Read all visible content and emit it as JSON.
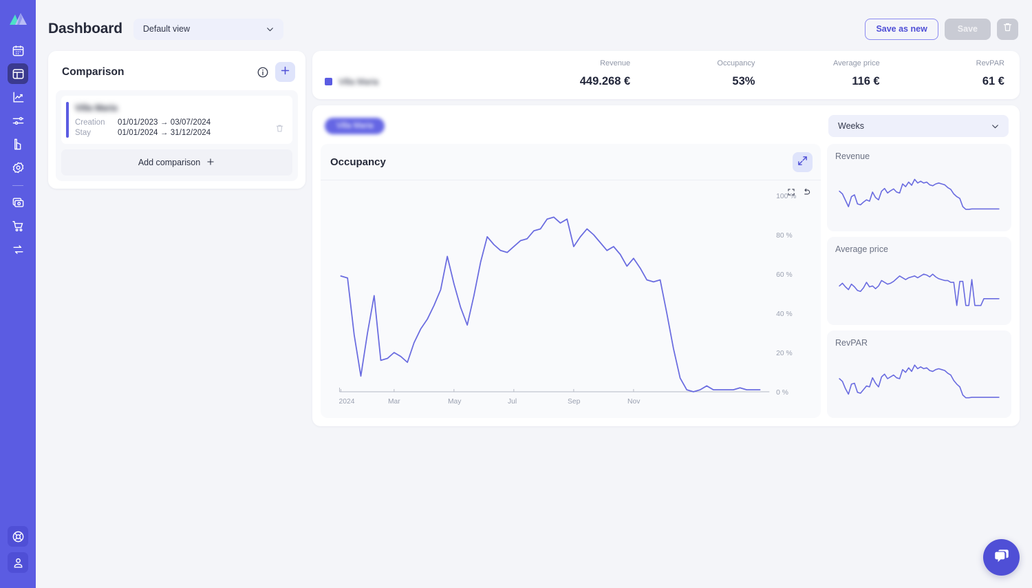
{
  "sidebar": {
    "logo_icon": "mountain-logo",
    "items": [
      {
        "icon": "calendar-icon",
        "name": "calendar",
        "active": false
      },
      {
        "icon": "dashboard-icon",
        "name": "dashboard",
        "active": true
      },
      {
        "icon": "analytics-chart-icon",
        "name": "analytics",
        "active": false
      },
      {
        "icon": "sliders-icon",
        "name": "settings-sliders",
        "active": false
      },
      {
        "icon": "report-icon",
        "name": "reports",
        "active": false
      },
      {
        "icon": "gear-icon",
        "name": "configuration",
        "active": false
      },
      {
        "icon": "money-icon",
        "name": "billing",
        "active": false
      },
      {
        "icon": "cart-icon",
        "name": "shop",
        "active": false
      },
      {
        "icon": "sync-icon",
        "name": "sync",
        "active": false
      }
    ],
    "bottom_items": [
      {
        "icon": "lifebuoy-icon",
        "name": "help"
      },
      {
        "icon": "user-icon",
        "name": "account"
      }
    ]
  },
  "header": {
    "title": "Dashboard",
    "view_select": {
      "value": "Default view",
      "chevron_icon": "chevron-down-icon"
    },
    "save_as_new_label": "Save as new",
    "save_label": "Save",
    "delete_icon": "trash-icon"
  },
  "comparison": {
    "title": "Comparison",
    "info_icon": "info-icon",
    "add_icon": "plus-icon",
    "item": {
      "name": "Villa Maria",
      "creation_label": "Creation",
      "creation_value": "01/01/2023 → 03/07/2024",
      "stay_label": "Stay",
      "stay_value": "01/01/2024 → 31/12/2024",
      "delete_icon": "trash-icon"
    },
    "add_comparison_label": "Add comparison",
    "add_comparison_icon": "plus-icon"
  },
  "kpi": {
    "headers": [
      "",
      "Revenue",
      "Occupancy",
      "Average price",
      "RevPAR"
    ],
    "row": {
      "name": "Villa Maria",
      "swatch_color": "#5b5ce2",
      "values": [
        "449.268 €",
        "53%",
        "116 €",
        "61 €"
      ]
    }
  },
  "toolbar": {
    "chip_label": "Villa Maria",
    "granularity": {
      "value": "Weeks",
      "chevron_icon": "chevron-down-icon"
    }
  },
  "main_chart": {
    "title": "Occupancy",
    "expand_icon": "expand-arrows-icon",
    "zoom_reset_icon": "zoom-box-icon",
    "undo_icon": "undo-arrow-icon",
    "line_color": "#6a6ce0"
  },
  "mini_charts": [
    {
      "title": "Revenue",
      "line_color": "#6a6ce0"
    },
    {
      "title": "Average price",
      "line_color": "#6a6ce0"
    },
    {
      "title": "RevPAR",
      "line_color": "#6a6ce0"
    }
  ],
  "chat": {
    "icon": "chat-bubbles-icon",
    "color": "#4f4fd6"
  },
  "chart_data": {
    "type": "line",
    "title": "Occupancy",
    "xlabel": "",
    "ylabel": "",
    "ylim": [
      0,
      100
    ],
    "ytick_labels": [
      "0 %",
      "20 %",
      "40 %",
      "60 %",
      "80 %",
      "100 %"
    ],
    "yticks": [
      0,
      20,
      40,
      60,
      80,
      100
    ],
    "xtick_labels": [
      "2024",
      "Mar",
      "May",
      "Jul",
      "Sep",
      "Nov"
    ],
    "xticks": [
      0,
      8,
      17,
      26,
      35,
      44
    ],
    "grid": false,
    "legend": false,
    "series": [
      {
        "name": "Villa Maria",
        "color": "#6a6ce0",
        "values": [
          59,
          58,
          29,
          8,
          30,
          49,
          16,
          17,
          20,
          18,
          15,
          25,
          32,
          37,
          44,
          52,
          69,
          55,
          43,
          34,
          49,
          66,
          79,
          75,
          72,
          71,
          74,
          77,
          78,
          82,
          83,
          88,
          89,
          86,
          88,
          74,
          79,
          83,
          80,
          76,
          72,
          74,
          70,
          64,
          68,
          63,
          57,
          56,
          57,
          40,
          22,
          7,
          1,
          0,
          1,
          3,
          1,
          1,
          1,
          1,
          2,
          1,
          1,
          1
        ]
      }
    ],
    "mini_series": [
      {
        "name": "Revenue",
        "ylim": [
          0,
          100
        ],
        "values": [
          52,
          46,
          32,
          18,
          40,
          44,
          24,
          22,
          28,
          33,
          30,
          50,
          38,
          33,
          52,
          58,
          48,
          53,
          57,
          50,
          48,
          68,
          62,
          72,
          65,
          78,
          70,
          74,
          70,
          72,
          66,
          64,
          68,
          70,
          68,
          66,
          60,
          56,
          46,
          40,
          36,
          18,
          12,
          12,
          13,
          13,
          13,
          13,
          13,
          13,
          13,
          13,
          13,
          13
        ]
      },
      {
        "name": "Average price",
        "ylim": [
          0,
          100
        ],
        "values": [
          48,
          54,
          46,
          40,
          52,
          46,
          38,
          36,
          44,
          56,
          46,
          48,
          42,
          48,
          60,
          56,
          52,
          54,
          58,
          64,
          70,
          66,
          62,
          66,
          68,
          70,
          66,
          70,
          74,
          72,
          68,
          74,
          68,
          64,
          62,
          60,
          60,
          56,
          56,
          5,
          58,
          58,
          5,
          5,
          62,
          5,
          5,
          5,
          20,
          20,
          20,
          20,
          20,
          20
        ]
      },
      {
        "name": "RevPAR",
        "ylim": [
          0,
          100
        ],
        "values": [
          50,
          44,
          28,
          16,
          38,
          40,
          20,
          18,
          26,
          34,
          32,
          52,
          40,
          32,
          54,
          60,
          50,
          54,
          58,
          52,
          50,
          70,
          64,
          74,
          66,
          80,
          72,
          76,
          72,
          74,
          68,
          66,
          70,
          72,
          70,
          68,
          62,
          58,
          46,
          38,
          32,
          14,
          8,
          8,
          9,
          9,
          9,
          9,
          9,
          9,
          9,
          9,
          9,
          9
        ]
      }
    ]
  }
}
